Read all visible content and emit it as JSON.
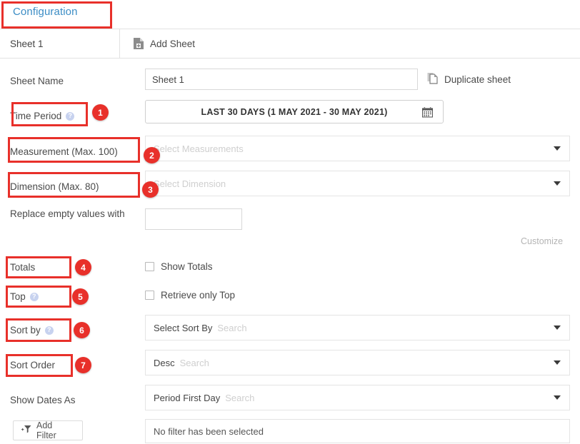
{
  "topbar": {
    "tab_label": "Configuration"
  },
  "sheetstrip": {
    "sheet_tab_label": "Sheet 1",
    "add_sheet_label": "Add Sheet",
    "add_sheet_icon": "add-document-icon"
  },
  "form": {
    "sheet_name": {
      "label": "Sheet Name",
      "value": "Sheet 1",
      "duplicate_label": "Duplicate sheet",
      "duplicate_icon": "copy-sheet-icon"
    },
    "time_period": {
      "label": "Time Period",
      "help": "help-icon",
      "value": "LAST 30 DAYS (1 MAY 2021 - 30 MAY 2021)",
      "calendar_icon": "calendar-icon"
    },
    "measurement": {
      "label": "Measurement (Max. 100)",
      "placeholder": "Select Measurements",
      "caret_icon": "chevron-down-icon"
    },
    "dimension": {
      "label": "Dimension (Max. 80)",
      "placeholder": "Select Dimension",
      "caret_icon": "chevron-down-icon"
    },
    "replace_empty": {
      "label": "Replace empty values with",
      "value": ""
    },
    "customize_link": "Customize",
    "totals": {
      "label": "Totals",
      "checkbox_label": "Show Totals",
      "checked": false
    },
    "top": {
      "label": "Top",
      "help": "help-icon",
      "checkbox_label": "Retrieve only Top",
      "checked": false
    },
    "sort_by": {
      "label": "Sort by",
      "help": "help-icon",
      "value": "Select Sort By",
      "search_placeholder": "Search",
      "caret_icon": "chevron-down-icon"
    },
    "sort_order": {
      "label": "Sort Order",
      "value": "Desc",
      "search_placeholder": "Search",
      "caret_icon": "chevron-down-icon"
    },
    "show_dates_as": {
      "label": "Show Dates As",
      "value": "Period First Day",
      "search_placeholder": "Search",
      "caret_icon": "chevron-down-icon"
    },
    "filter": {
      "button_label": "Add Filter",
      "button_icon": "add-filter-icon",
      "status": "No filter has been selected"
    }
  },
  "annotations": {
    "accent_color": "#e8302a",
    "badges": [
      {
        "n": "1"
      },
      {
        "n": "2"
      },
      {
        "n": "3"
      },
      {
        "n": "4"
      },
      {
        "n": "5"
      },
      {
        "n": "6"
      },
      {
        "n": "7"
      }
    ]
  }
}
